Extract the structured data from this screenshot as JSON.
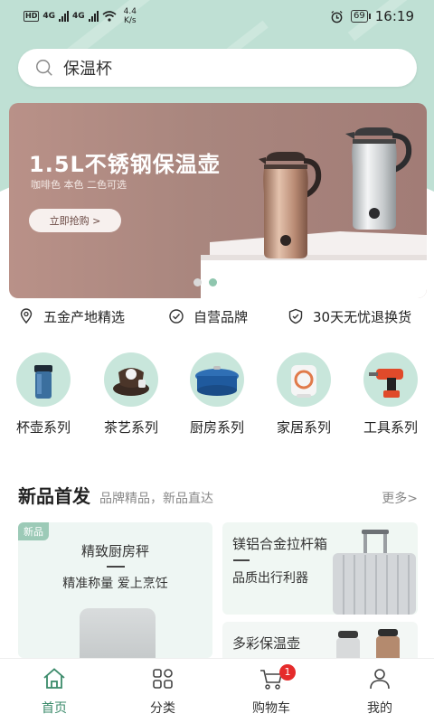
{
  "status_bar": {
    "left": [
      "HD",
      "4G",
      "4G"
    ],
    "speed_value": "4.4",
    "speed_unit": "K/s",
    "battery": "69",
    "time": "16:19"
  },
  "search": {
    "placeholder": "保温杯"
  },
  "banner": {
    "title": "1.5L不锈钢保温壶",
    "subtitle": "咖啡色 本色 二色可选",
    "button": "立即抢购 >",
    "slide_count": 2,
    "active_slide": 2
  },
  "guarantees": [
    {
      "icon": "location-pin-icon",
      "text": "五金产地精选"
    },
    {
      "icon": "check-circle-icon",
      "text": "自营品牌"
    },
    {
      "icon": "shield-check-icon",
      "text": "30天无忧退换货"
    }
  ],
  "categories": [
    {
      "label": "杯壶系列",
      "icon": "tumbler-icon"
    },
    {
      "label": "茶艺系列",
      "icon": "tea-set-icon"
    },
    {
      "label": "厨房系列",
      "icon": "casserole-pot-icon"
    },
    {
      "label": "家居系列",
      "icon": "heater-icon"
    },
    {
      "label": "工具系列",
      "icon": "power-drill-icon"
    }
  ],
  "new_products": {
    "title": "新品首发",
    "subtitle": "品牌精品，新品直达",
    "more": "更多>",
    "cards": [
      {
        "badge": "新品",
        "title": "精致厨房秤",
        "subtitle": "精准称量 爱上烹饪"
      },
      {
        "title": "镁铝合金拉杆箱",
        "subtitle": "品质出行利器"
      },
      {
        "title": "多彩保温壶"
      }
    ]
  },
  "bottom_nav": [
    {
      "label": "首页",
      "icon": "home-icon",
      "active": true
    },
    {
      "label": "分类",
      "icon": "category-grid-icon"
    },
    {
      "label": "购物车",
      "icon": "cart-icon",
      "badge": "1"
    },
    {
      "label": "我的",
      "icon": "user-icon"
    }
  ],
  "colors": {
    "accent": "#3a8a6a",
    "mint": "#bfe0d4",
    "badge": "#e52b2b",
    "banner": "#a9867e"
  }
}
